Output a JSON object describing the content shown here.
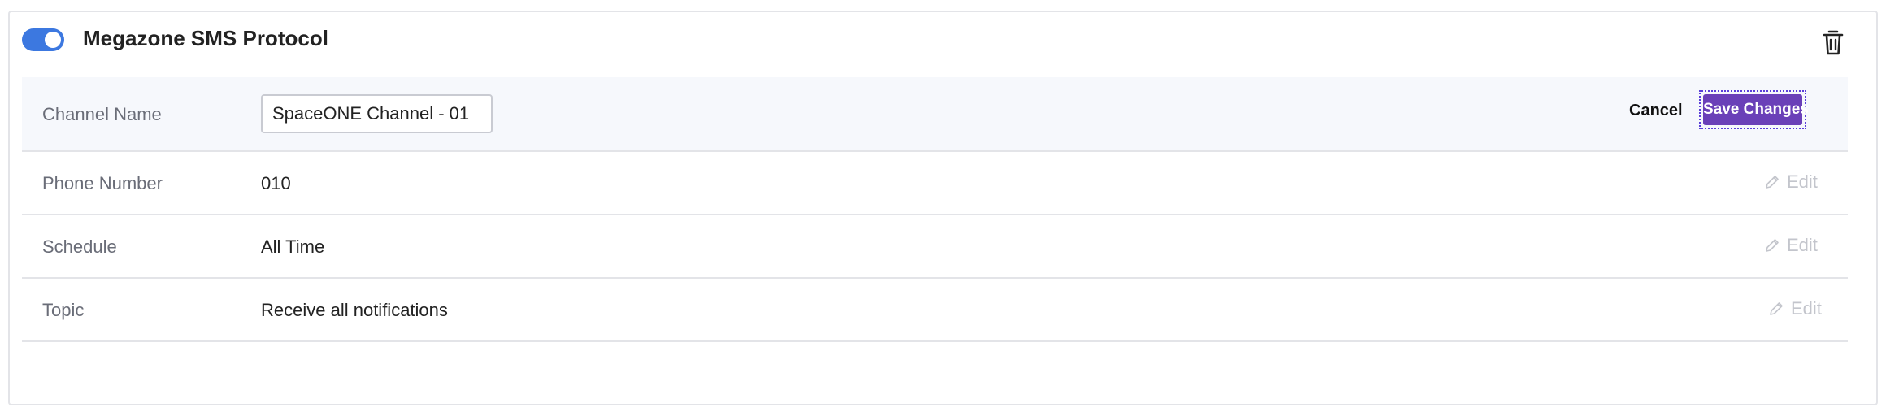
{
  "channel": {
    "title": "Megazone SMS Protocol",
    "enabled": true,
    "toggle_icon": "toggle-on-icon",
    "delete_icon": "trash-icon",
    "accent_color": "#3c78e0"
  },
  "rows": {
    "channel_name": {
      "label": "Channel Name",
      "input_value": "SpaceONE Channel - 01",
      "cancel_label": "Cancel",
      "save_label": "Save Changes",
      "save_color": "#6a40b8"
    },
    "phone_number": {
      "label": "Phone Number",
      "value": "010",
      "edit_label": "Edit",
      "edit_icon": "pencil-icon"
    },
    "schedule": {
      "label": "Schedule",
      "value": "All Time",
      "edit_label": "Edit",
      "edit_icon": "pencil-icon"
    },
    "topic": {
      "label": "Topic",
      "value": "Receive all notifications",
      "edit_label": "Edit",
      "edit_icon": "pencil-icon"
    }
  }
}
